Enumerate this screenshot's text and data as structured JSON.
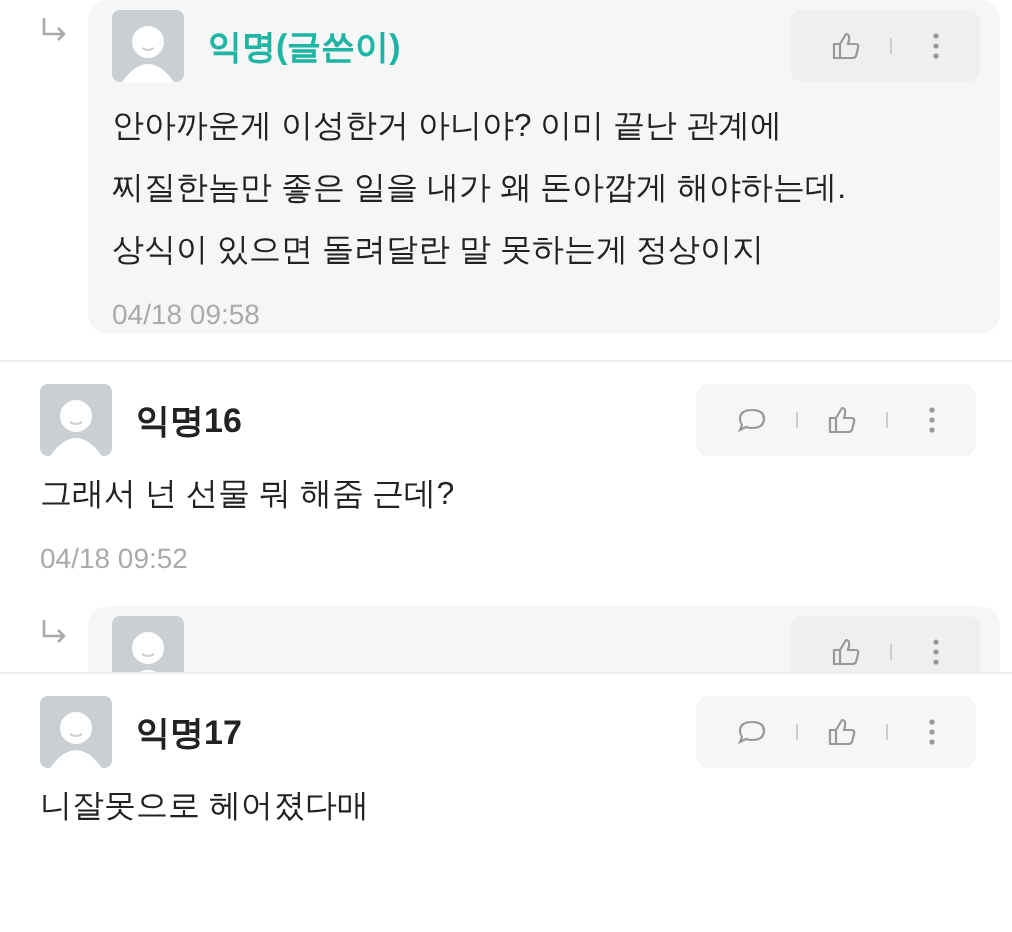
{
  "comments": [
    {
      "kind": "reply",
      "author": "익명(글쓴이)",
      "author_is_op": true,
      "body": "안아까운게 이성한거 아니야? 이미 끝난 관계에\n찌질한놈만 좋은 일을 내가 왜 돈아깝게 해야하는데.\n상식이 있으면 돌려달란 말 못하는게 정상이지",
      "time": "04/18 09:58"
    },
    {
      "kind": "comment",
      "author": "익명16",
      "author_is_op": false,
      "body": "그래서 넌 선물 뭐 해줌 근데?",
      "time": "04/18 09:52"
    },
    {
      "kind": "reply_stub"
    },
    {
      "kind": "comment",
      "author": "익명17",
      "author_is_op": false,
      "body": "니잘못으로 헤어졌다매"
    }
  ]
}
